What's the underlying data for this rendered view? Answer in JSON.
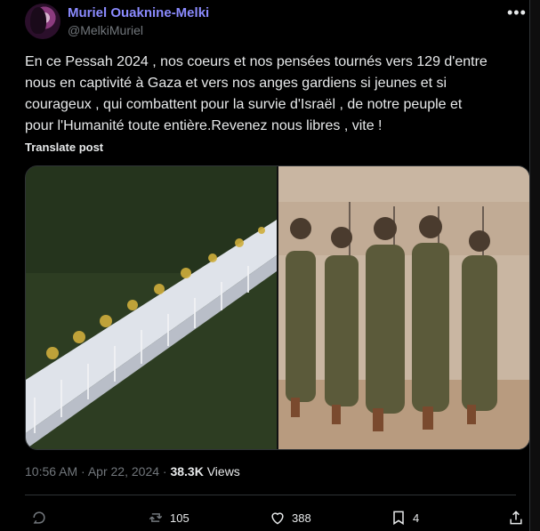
{
  "author": {
    "display_name": "Muriel Ouaknine-Melki",
    "handle": "@MelkiMuriel"
  },
  "post": {
    "text": "En ce Pessah  2024 , nos coeurs et nos pensées tournés vers 129 d'entre\nnous en captivité à Gaza et vers nos anges gardiens si jeunes et si\ncourageux , qui combattent  pour la survie d'Israël , de notre peuple  et\npour l'Humanité toute entière.Revenez nous libres , vite !",
    "translate_label": "Translate post",
    "time": "10:56 AM",
    "date": "Apr 22, 2024",
    "separator": "·",
    "views_count": "38.3K",
    "views_label": "Views"
  },
  "actions": {
    "replies": "",
    "reposts": "105",
    "likes": "388",
    "bookmarks": "4"
  },
  "icons": [
    "more-icon",
    "reply-icon",
    "repost-icon",
    "like-icon",
    "bookmark-icon",
    "share-icon"
  ],
  "colors": {
    "background": "#000000",
    "name_accent": "#8b8bff",
    "muted": "#71767b",
    "text": "#e7e9ea"
  }
}
